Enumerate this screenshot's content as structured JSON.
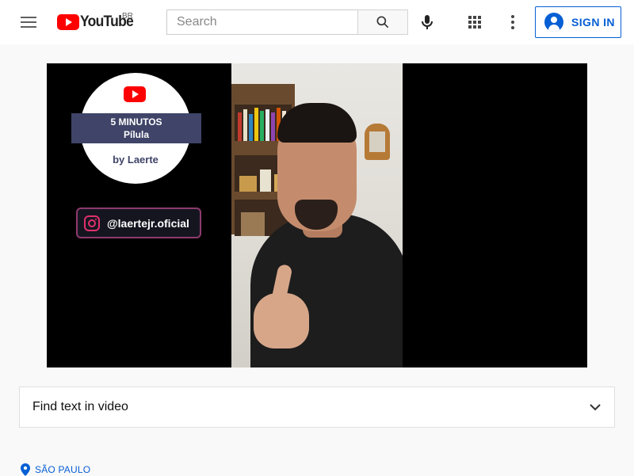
{
  "header": {
    "logo_text": "YouTube",
    "region": "BR",
    "search_placeholder": "Search",
    "signin_label": "SIGN IN",
    "icons": {
      "menu": "hamburger-menu-icon",
      "search": "search-icon",
      "mic": "mic-icon",
      "apps": "apps-grid-icon",
      "more": "more-vert-icon",
      "account": "account-circle-icon"
    }
  },
  "video": {
    "badge_title": "5 MINUTOS",
    "badge_subtitle": "Pílula",
    "badge_by": "by Laerte",
    "instagram_handle": "@laertejr.oficial"
  },
  "find_text": {
    "label": "Find text in video",
    "icon": "chevron-down-icon"
  },
  "location": {
    "label": "SÃO PAULO",
    "icon": "location-pin-icon"
  },
  "colors": {
    "brand_red": "#ff0000",
    "link_blue": "#065fd4",
    "background": "#f9f9f9"
  }
}
